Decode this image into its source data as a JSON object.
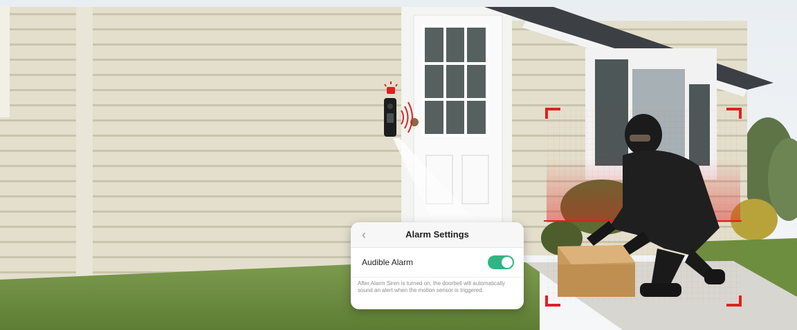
{
  "alarm_settings": {
    "title": "Alarm Settings",
    "back_icon": "chevron-left-icon",
    "audible_alarm_label": "Audible Alarm",
    "audible_alarm_on": true,
    "help_text": "After Alarm Siren is turned on, the doorbell will automatically sound an alert when the motion sensor is triggered."
  },
  "colors": {
    "toggle_on": "#2fb583",
    "detection_frame": "#e0201f",
    "siren": "#e0201f"
  },
  "icons": {
    "siren_icon": "alarm-light-icon",
    "sound_waves": "sound-waves-icon"
  }
}
